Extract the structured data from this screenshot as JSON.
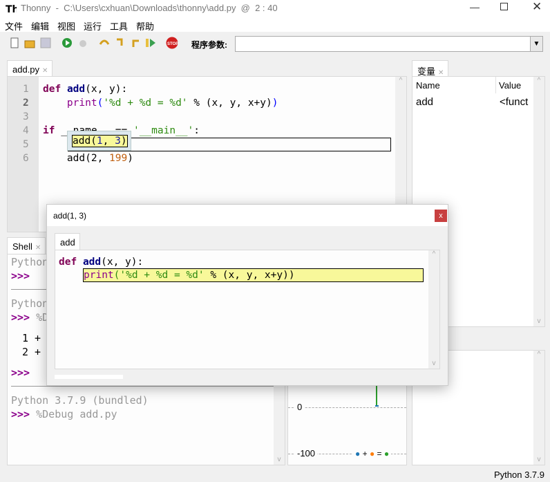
{
  "window": {
    "title": "Thonny  -  C:\\Users\\cxhuan\\Downloads\\thonny\\add.py  @  2 : 40"
  },
  "menu": [
    "文件",
    "编辑",
    "视图",
    "运行",
    "工具",
    "帮助"
  ],
  "toolbar": {
    "icons": [
      "new-file-icon",
      "open-file-icon",
      "save-icon",
      "run-icon",
      "debug-icon",
      "step-over-icon",
      "step-into-icon",
      "step-out-icon",
      "resume-icon",
      "stop-icon"
    ],
    "args_label": "程序参数:",
    "args_value": ""
  },
  "editor": {
    "tab": "add.py",
    "line_numbers": [
      "1",
      "2",
      "3",
      "4",
      "5",
      "6"
    ],
    "lines": {
      "l1a": "def",
      "l1b": "add",
      "l1c": "(x, y):",
      "l2a": "    print",
      "l2b": "(",
      "l2c": "'%d + %d = %d'",
      "l2d": " % (x, y, x+y)",
      "l2e": ")",
      "l4a": "if",
      "l4b": " __name__ == ",
      "l4c": "'__main__'",
      "l4d": ":",
      "l6a": "    add(2, ",
      "l6b": "199",
      "l6c": ")"
    },
    "popup": {
      "a": "add(",
      "b": "1",
      "c": ", ",
      "d": "3",
      "e": ")"
    }
  },
  "variables": {
    "tab": "变量",
    "columns": [
      "Name",
      "Value"
    ],
    "rows": [
      {
        "name": "add",
        "value": "<funct"
      }
    ]
  },
  "shell": {
    "tab": "Shell",
    "lines": [
      "Python",
      "%D",
      "1 +",
      "2 +",
      "Python 3.7.9 (bundled)",
      "%Debug add.py"
    ],
    "prompt": ">>>"
  },
  "plot": {
    "ticks": [
      "0",
      "-100"
    ],
    "legend": [
      "+",
      "="
    ],
    "colors": [
      "#1f77b4",
      "#ff7f0e",
      "#2ca02c"
    ]
  },
  "dialog": {
    "title": "add(1, 3)",
    "tab": "add",
    "l1a": "def",
    "l1b": "add",
    "l1c": "(x, y):",
    "l2a": "print",
    "l2b": "('%d + %d = %d'",
    "l2c": " % (x, y, x+y))"
  },
  "status": {
    "text": "Python 3.7.9"
  }
}
